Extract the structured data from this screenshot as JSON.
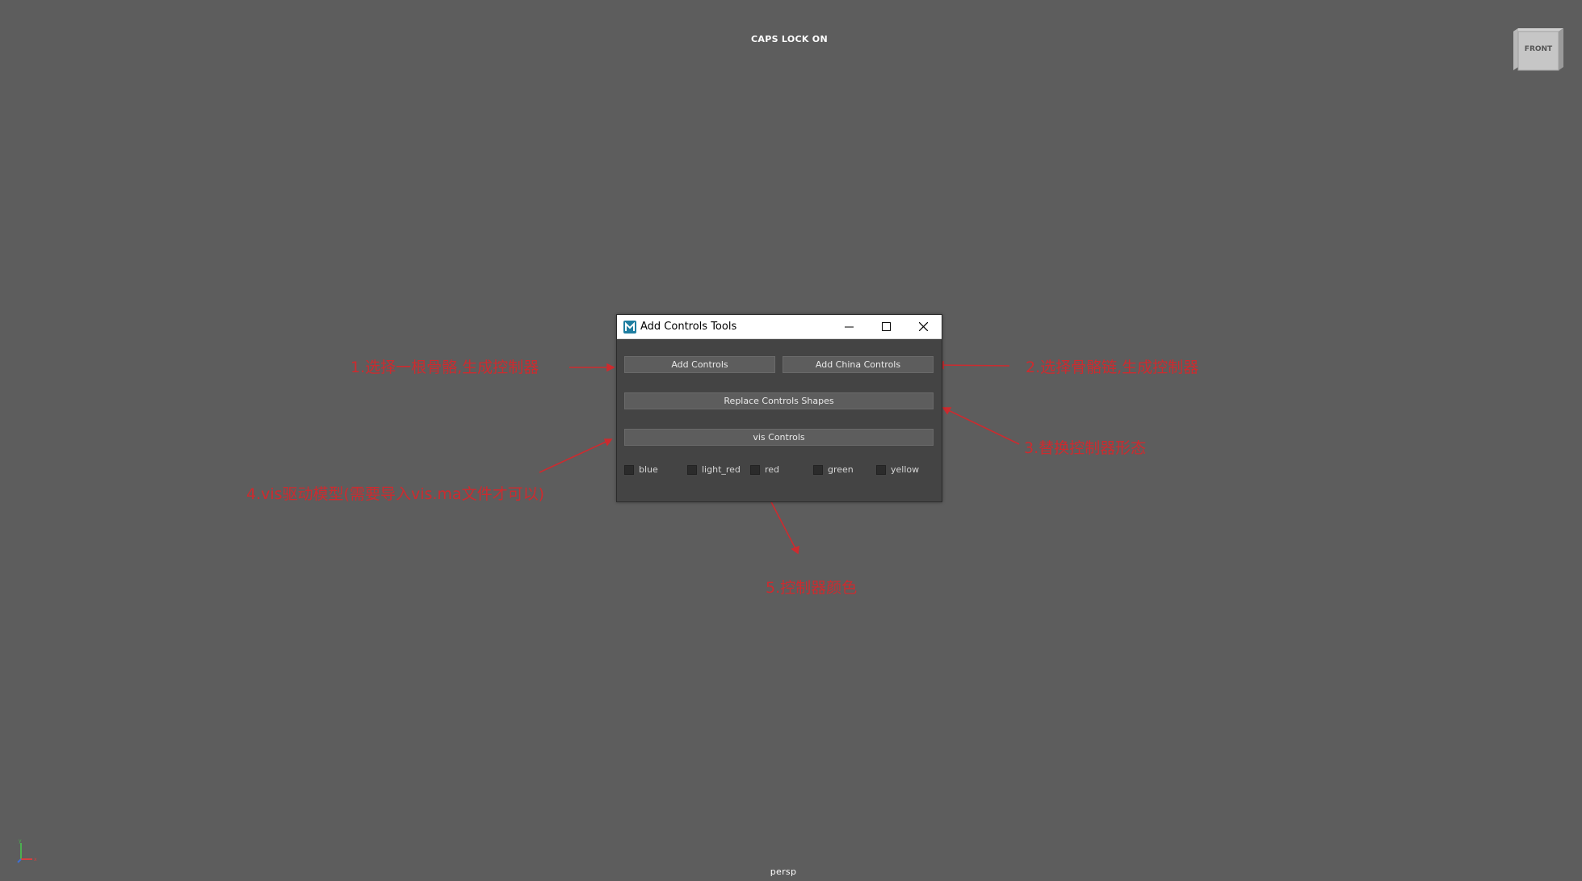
{
  "viewport": {
    "caps_lock": "CAPS LOCK ON",
    "camera": "persp",
    "viewcube_label": "FRONT",
    "background_color": "#5d5d5d"
  },
  "dialog": {
    "title": "Add Controls Tools",
    "buttons": {
      "add_controls": "Add Controls",
      "add_china_controls": "Add China Controls",
      "replace_shapes": "Replace Controls Shapes",
      "vis_controls": "vis Controls"
    },
    "colors": [
      {
        "label": "blue",
        "checked": false
      },
      {
        "label": "light_red",
        "checked": false
      },
      {
        "label": "red",
        "checked": false
      },
      {
        "label": "green",
        "checked": false
      },
      {
        "label": "yellow",
        "checked": false
      }
    ]
  },
  "annotations": {
    "a1": "1.选择一根骨骼,生成控制器",
    "a2": "2.选择骨骼链,生成控制器",
    "a3": "3.替换控制器形态",
    "a4": "4.vis驱动模型(需要导入vis.ma文件才可以)",
    "a5": "5.控制器颜色",
    "color": "#d9262b"
  }
}
